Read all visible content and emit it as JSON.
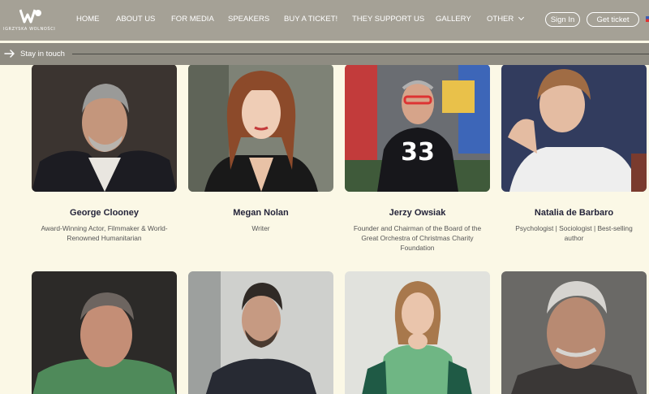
{
  "brand": {
    "logo_text": "IGRZYSKA WOLNOŚCI"
  },
  "nav": {
    "items": [
      {
        "label": "HOME"
      },
      {
        "label": "ABOUT US"
      },
      {
        "label": "FOR MEDIA"
      },
      {
        "label": "SPEAKERS"
      },
      {
        "label": "BUY A TICKET!"
      },
      {
        "label": "THEY SUPPORT US"
      },
      {
        "label": "GALLERY"
      },
      {
        "label": "OTHER"
      }
    ],
    "sign_in": "Sign In",
    "get_ticket": "Get ticket"
  },
  "stay_in_touch": {
    "label": "Stay in touch"
  },
  "speakers": [
    {
      "name": "George Clooney",
      "role": "Award-Winning Actor, Filmmaker & World-Renowned Humanitarian"
    },
    {
      "name": "Megan Nolan",
      "role": "Writer"
    },
    {
      "name": "Jerzy Owsiak",
      "role": "Founder and Chairman of the Board of the Great Orchestra of Christmas Charity Foundation"
    },
    {
      "name": "Natalia de Barbaro",
      "role": "Psychologist | Sociologist | Best-selling author"
    }
  ],
  "colors": {
    "page_background": "#fbf8e6",
    "header_background": "#a5a196",
    "name_text": "#24243a"
  }
}
